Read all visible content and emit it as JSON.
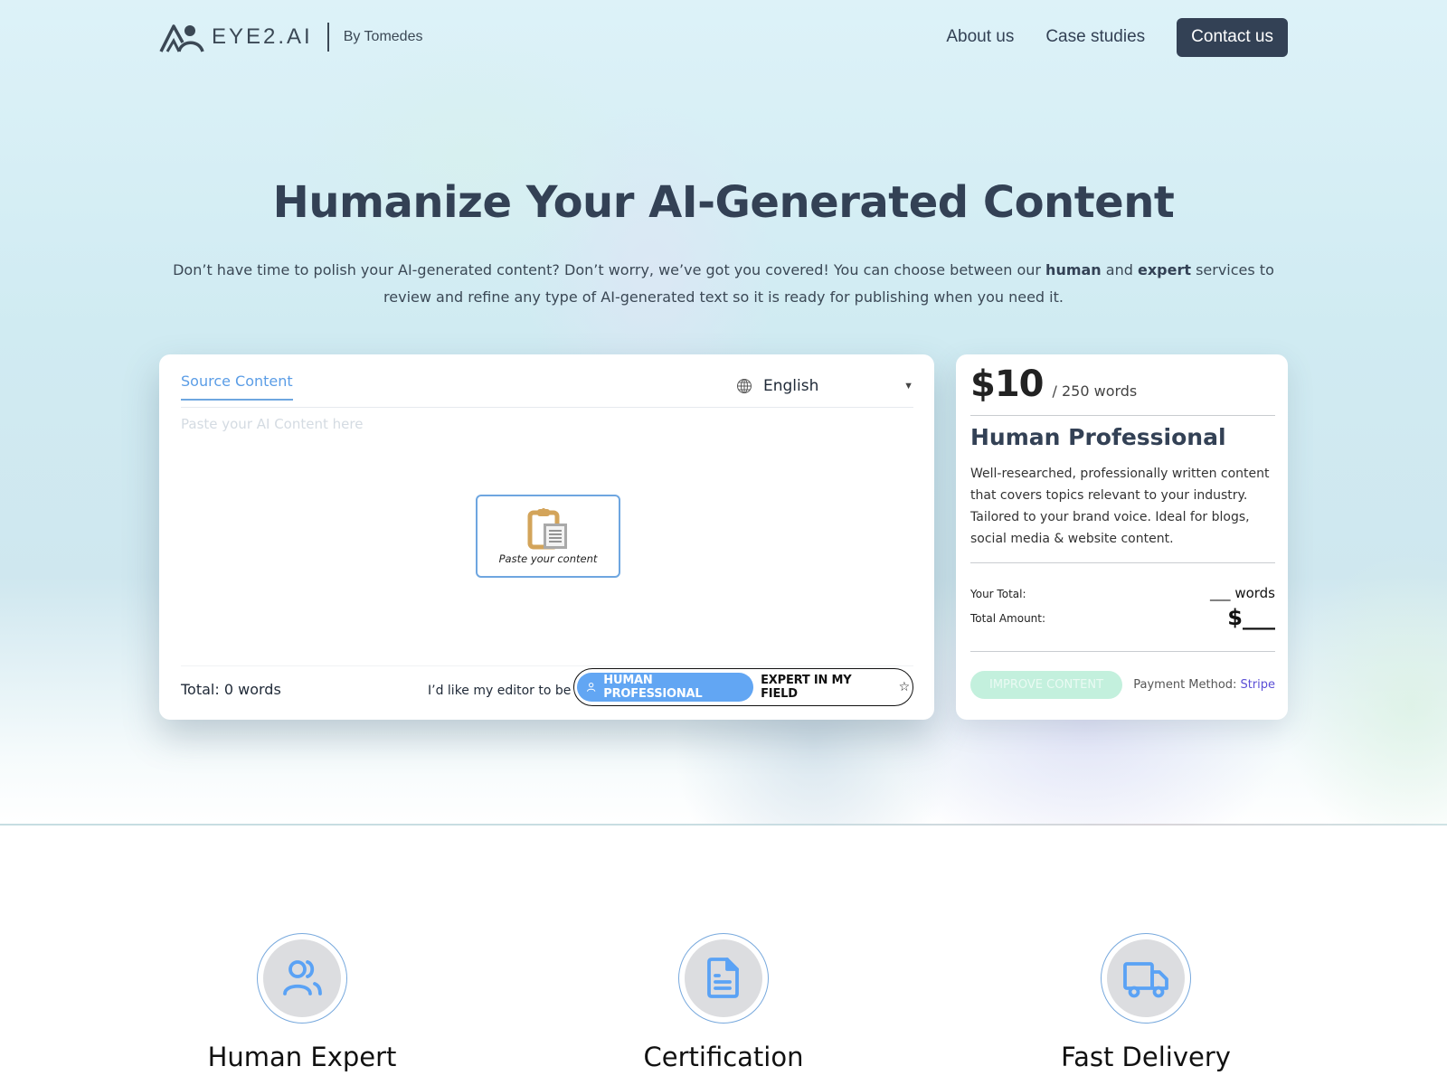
{
  "header": {
    "logo_text": "EYE2.AI",
    "logo_by": "By Tomedes",
    "nav": [
      {
        "label": "About us"
      },
      {
        "label": "Case studies"
      }
    ],
    "contact_label": "Contact us"
  },
  "hero": {
    "title": "Humanize Your AI-Generated Content",
    "subtitle_parts": {
      "p1": "Don’t have time to polish your AI-generated content? Don’t worry, we’ve got you covered! You can choose between our ",
      "b1": "human",
      "p2": " and ",
      "b2": "expert",
      "p3": " services to review and refine any type of AI-generated text so it is ready for publishing when you need it."
    }
  },
  "editor": {
    "tab_label": "Source Content",
    "language": "English",
    "placeholder": "Paste your AI Content here",
    "paste_label": "Paste your content",
    "total_words": "Total: 0 words",
    "editor_pref_label": "I’d like my editor to be",
    "options": [
      {
        "label": "HUMAN PROFESSIONAL",
        "icon": "person-icon",
        "selected": true
      },
      {
        "label": "EXPERT IN MY FIELD",
        "icon": "star-icon",
        "selected": false
      }
    ]
  },
  "pricing": {
    "price": "$10",
    "unit": "/ 250 words",
    "plan_title": "Human Professional",
    "plan_description": "Well-researched, professionally written content that covers topics relevant to your industry. Tailored to your brand voice. Ideal for blogs, social media & website content.",
    "your_total_label": "Your Total:",
    "your_total_value": "___ words",
    "total_amount_label": "Total Amount:",
    "total_amount_value": "$___",
    "improve_label": "IMPROVE CONTENT",
    "payment_label": "Payment Method:",
    "payment_method": "Stripe"
  },
  "features": [
    {
      "title": "Human Expert",
      "icon": "users-icon"
    },
    {
      "title": "Certification",
      "icon": "document-icon"
    },
    {
      "title": "Fast Delivery",
      "icon": "truck-icon"
    }
  ],
  "colors": {
    "primary_dark": "#334155",
    "accent_blue": "#62a6f3",
    "improve_button": "#c3f0dd",
    "stripe_link": "#5b4fd6"
  }
}
